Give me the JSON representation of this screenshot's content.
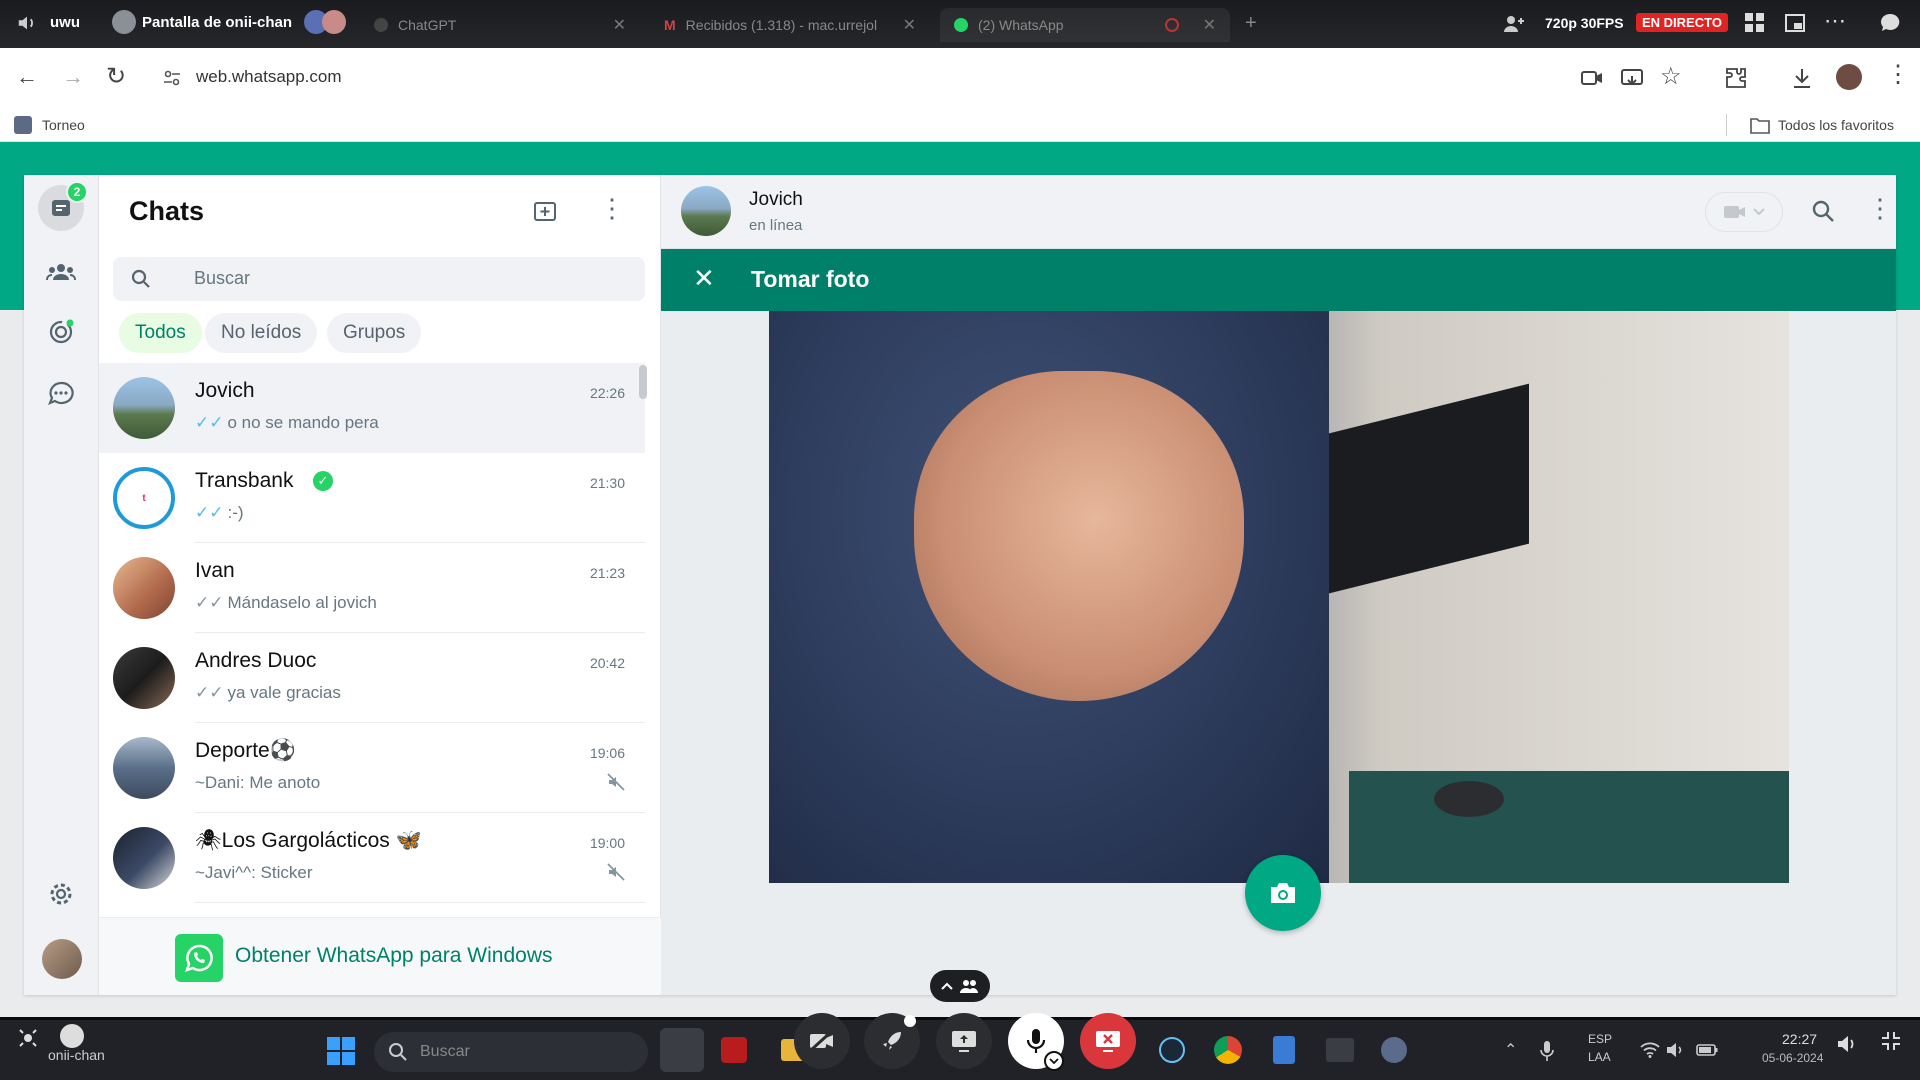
{
  "overlay": {
    "user_name": "uwu",
    "stream_title": "Pantalla de onii-chan",
    "quality": "720p 30FPS",
    "live_badge": "EN DIRECTO",
    "streamer_name": "onii-chan"
  },
  "browser": {
    "tabs": [
      {
        "label": "ChatGPT"
      },
      {
        "label": "Recibidos (1.318) - mac.urrejol"
      },
      {
        "label": "(2) WhatsApp"
      }
    ],
    "url": "web.whatsapp.com",
    "bookmark_left": "Torneo",
    "bookmark_right": "Todos los favoritos"
  },
  "whatsapp": {
    "accent": "#00a884",
    "rail_badge": "2",
    "list_title": "Chats",
    "search_placeholder": "Buscar",
    "filters": [
      "Todos",
      "No leídos",
      "Grupos"
    ],
    "chats": [
      {
        "name": "Jovich",
        "time": "22:26",
        "preview": "o no se mando pera",
        "ticks": "✓✓",
        "muted": false,
        "verified": false
      },
      {
        "name": "Transbank",
        "time": "21:30",
        "preview": ":-)",
        "ticks": "✓✓",
        "muted": false,
        "verified": true
      },
      {
        "name": "Ivan",
        "time": "21:23",
        "preview": "Mándaselo al jovich",
        "ticks": "✓✓",
        "muted": false,
        "verified": false
      },
      {
        "name": "Andres Duoc",
        "time": "20:42",
        "preview": "ya vale gracias",
        "ticks": "✓✓",
        "muted": false,
        "verified": false
      },
      {
        "name": "Deporte⚽",
        "time": "19:06",
        "preview": "~Dani: Me anoto",
        "ticks": "",
        "muted": true,
        "verified": false
      },
      {
        "name": "🕷Los Gargolácticos 🦋",
        "time": "19:00",
        "preview": "~Javi^^: Sticker",
        "ticks": "",
        "muted": true,
        "verified": false
      }
    ],
    "get_app_banner": "Obtener WhatsApp para Windows",
    "conversation": {
      "contact_name": "Jovich",
      "contact_status": "en línea",
      "camera_title": "Tomar foto"
    }
  },
  "taskbar": {
    "search_placeholder": "Buscar",
    "lang_top": "ESP",
    "lang_bottom": "LAA",
    "time": "22:27",
    "date": "05-06-2024"
  }
}
